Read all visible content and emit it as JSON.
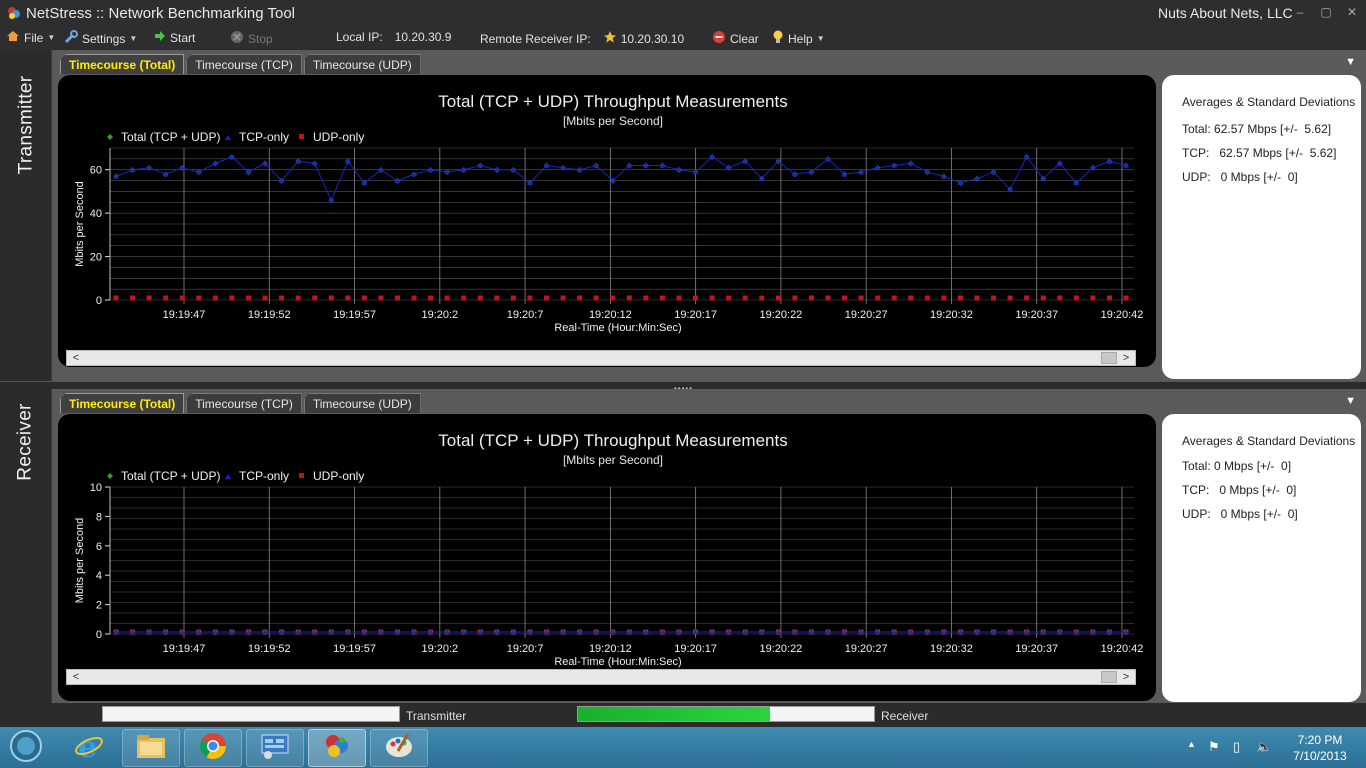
{
  "window": {
    "title": "NetStress :: Network Benchmarking Tool",
    "company": "Nuts About Nets, LLC"
  },
  "menu": {
    "file": "File",
    "settings": "Settings",
    "start": "Start",
    "stop": "Stop",
    "local_ip_label": "Local IP:",
    "local_ip": "10.20.30.9",
    "remote_ip_label": "Remote Receiver IP:",
    "remote_ip": "10.20.30.10",
    "clear": "Clear",
    "help": "Help"
  },
  "tabs": [
    "Timecourse (Total)",
    "Timecourse (TCP)",
    "Timecourse (UDP)"
  ],
  "transmitter": {
    "side_label": "Transmitter",
    "stats": {
      "heading": "Averages & Standard Deviations",
      "total": "Total: 62.57 Mbps [+/-  5.62]",
      "tcp": "TCP:   62.57 Mbps [+/-  5.62]",
      "udp": "UDP:   0 Mbps [+/-  0]"
    }
  },
  "receiver": {
    "side_label": "Receiver",
    "stats": {
      "heading": "Averages & Standard Deviations",
      "total": "Total: 0 Mbps [+/-  0]",
      "tcp": "TCP:   0 Mbps [+/-  0]",
      "udp": "UDP:   0 Mbps [+/-  0]"
    }
  },
  "chart_data": [
    {
      "type": "line",
      "title": "Total (TCP + UDP) Throughput Measurements",
      "subtitle": "[Mbits per Second]",
      "xlabel": "Real-Time (Hour:Min:Sec)",
      "ylabel": "Mbits per Second",
      "ylim": [
        0,
        70
      ],
      "yticks": [
        0,
        20,
        40,
        60
      ],
      "xtick_labels": [
        "19:19:47",
        "19:19:52",
        "19:19:57",
        "19:20:2",
        "19:20:7",
        "19:20:12",
        "19:20:17",
        "19:20:22",
        "19:20:27",
        "19:20:32",
        "19:20:37",
        "19:20:42"
      ],
      "grid": true,
      "legend_position": "top-left",
      "series": [
        {
          "name": "Total (TCP + UDP)",
          "color": "#2fa02f",
          "values": [
            56,
            59,
            60,
            57,
            60,
            58,
            62,
            65,
            58,
            62,
            54,
            63,
            62,
            45,
            63,
            53,
            59,
            54,
            57,
            59,
            58,
            59,
            61,
            59,
            59,
            53,
            61,
            60,
            59,
            61,
            54,
            61,
            61,
            61,
            59,
            58,
            65,
            60,
            63,
            55,
            63,
            57,
            58,
            64,
            57,
            58,
            60,
            61,
            62,
            58,
            56,
            53,
            55,
            58,
            50,
            65,
            55,
            62,
            53,
            60,
            63,
            61
          ]
        },
        {
          "name": "TCP-only",
          "color": "#1b22c8",
          "values": [
            56,
            59,
            60,
            57,
            60,
            58,
            62,
            65,
            58,
            62,
            54,
            63,
            62,
            45,
            63,
            53,
            59,
            54,
            57,
            59,
            58,
            59,
            61,
            59,
            59,
            53,
            61,
            60,
            59,
            61,
            54,
            61,
            61,
            61,
            59,
            58,
            65,
            60,
            63,
            55,
            63,
            57,
            58,
            64,
            57,
            58,
            60,
            61,
            62,
            58,
            56,
            53,
            55,
            58,
            50,
            65,
            55,
            62,
            53,
            60,
            63,
            61
          ]
        },
        {
          "name": "UDP-only",
          "color": "#c41414",
          "values": [
            0,
            0,
            0,
            0,
            0,
            0,
            0,
            0,
            0,
            0,
            0,
            0,
            0,
            0,
            0,
            0,
            0,
            0,
            0,
            0,
            0,
            0,
            0,
            0,
            0,
            0,
            0,
            0,
            0,
            0,
            0,
            0,
            0,
            0,
            0,
            0,
            0,
            0,
            0,
            0,
            0,
            0,
            0,
            0,
            0,
            0,
            0,
            0,
            0,
            0,
            0,
            0,
            0,
            0,
            0,
            0,
            0,
            0,
            0,
            0,
            0,
            0
          ]
        }
      ]
    },
    {
      "type": "line",
      "title": "Total (TCP + UDP) Throughput Measurements",
      "subtitle": "[Mbits per Second]",
      "xlabel": "Real-Time (Hour:Min:Sec)",
      "ylabel": "Mbits per Second",
      "ylim": [
        0,
        10
      ],
      "yticks": [
        0,
        2,
        4,
        6,
        8,
        10
      ],
      "xtick_labels": [
        "19:19:47",
        "19:19:52",
        "19:19:57",
        "19:20:2",
        "19:20:7",
        "19:20:12",
        "19:20:17",
        "19:20:22",
        "19:20:27",
        "19:20:32",
        "19:20:37",
        "19:20:42"
      ],
      "grid": true,
      "legend_position": "top-left",
      "series": [
        {
          "name": "Total (TCP + UDP)",
          "color": "#2fa02f",
          "values": [
            0,
            0,
            0,
            0,
            0,
            0,
            0,
            0,
            0,
            0,
            0,
            0,
            0,
            0,
            0,
            0,
            0,
            0,
            0,
            0,
            0,
            0,
            0,
            0,
            0,
            0,
            0,
            0,
            0,
            0,
            0,
            0,
            0,
            0,
            0,
            0,
            0,
            0,
            0,
            0,
            0,
            0,
            0,
            0,
            0,
            0,
            0,
            0,
            0,
            0,
            0,
            0,
            0,
            0,
            0,
            0,
            0,
            0,
            0,
            0,
            0,
            0
          ]
        },
        {
          "name": "TCP-only",
          "color": "#1b22c8",
          "values": [
            0,
            0,
            0,
            0,
            0,
            0,
            0,
            0,
            0,
            0,
            0,
            0,
            0,
            0,
            0,
            0,
            0,
            0,
            0,
            0,
            0,
            0,
            0,
            0,
            0,
            0,
            0,
            0,
            0,
            0,
            0,
            0,
            0,
            0,
            0,
            0,
            0,
            0,
            0,
            0,
            0,
            0,
            0,
            0,
            0,
            0,
            0,
            0,
            0,
            0,
            0,
            0,
            0,
            0,
            0,
            0,
            0,
            0,
            0,
            0,
            0,
            0
          ]
        },
        {
          "name": "UDP-only",
          "color": "#c41414",
          "values": [
            0,
            0,
            0,
            0,
            0,
            0,
            0,
            0,
            0,
            0,
            0,
            0,
            0,
            0,
            0,
            0,
            0,
            0,
            0,
            0,
            0,
            0,
            0,
            0,
            0,
            0,
            0,
            0,
            0,
            0,
            0,
            0,
            0,
            0,
            0,
            0,
            0,
            0,
            0,
            0,
            0,
            0,
            0,
            0,
            0,
            0,
            0,
            0,
            0,
            0,
            0,
            0,
            0,
            0,
            0,
            0,
            0,
            0,
            0,
            0,
            0,
            0
          ]
        }
      ]
    }
  ],
  "status": {
    "transmitter_label": "Transmitter",
    "transmitter_progress": 0,
    "receiver_label": "Receiver",
    "receiver_progress": 0.65
  },
  "taskbar": {
    "time": "7:20 PM",
    "date": "7/10/2013"
  }
}
